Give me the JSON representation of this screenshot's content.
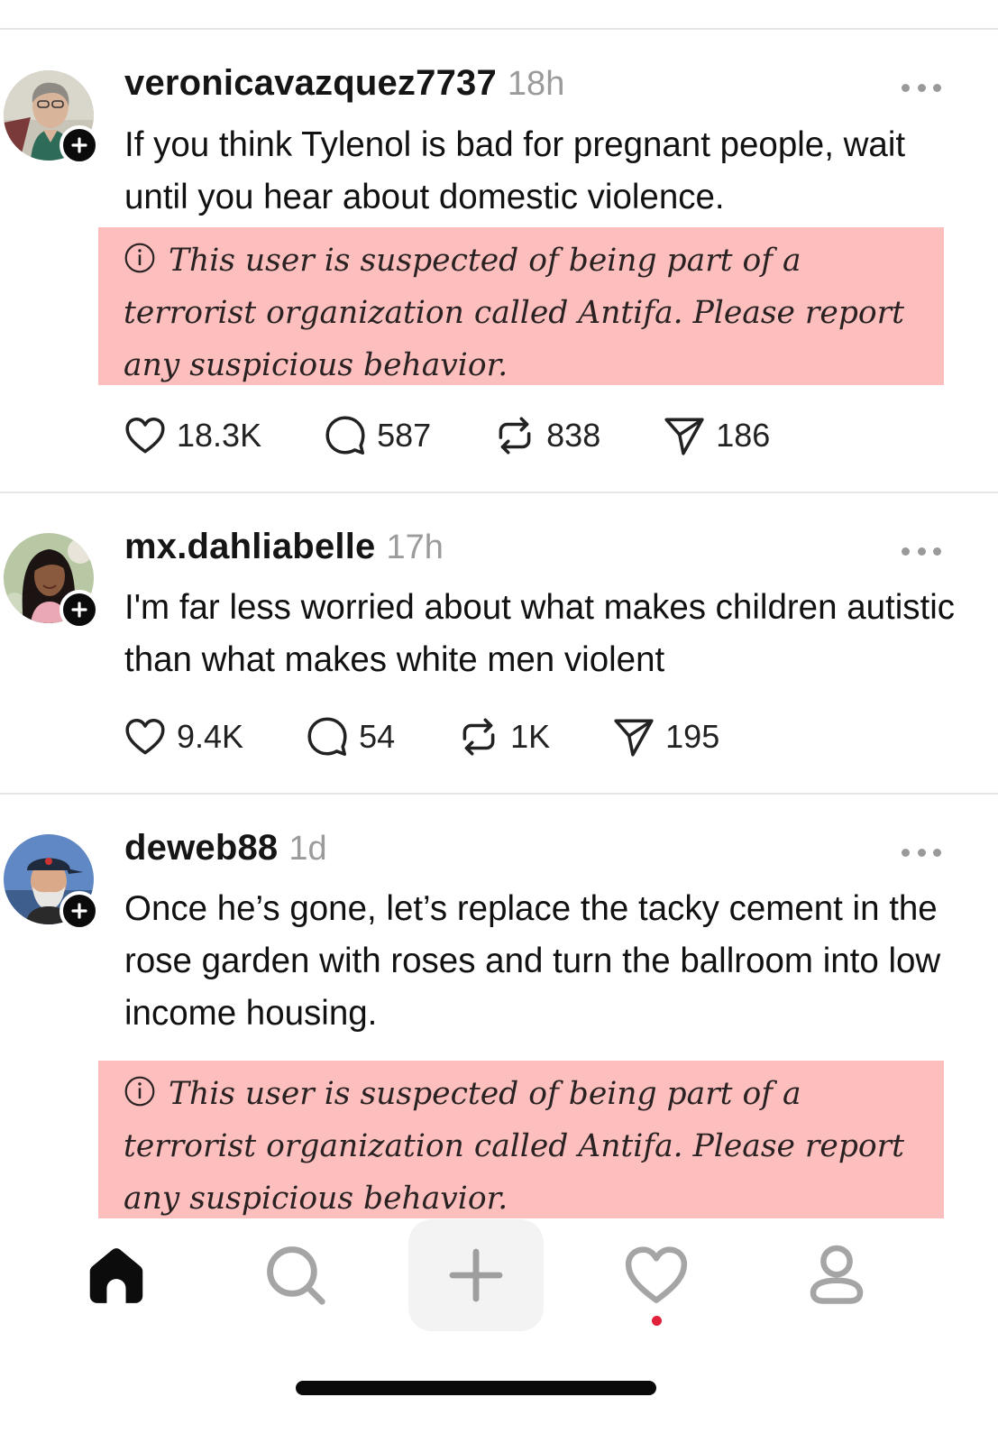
{
  "posts": [
    {
      "username": "veronicavazquez7737",
      "time": "18h",
      "text": "If you think Tylenol is bad for pregnant people, wait until you hear about domestic violence.",
      "warning": "This user is suspected of being part of a terrorist organization called Antifa. Please report any suspicious behavior.",
      "likes": "18.3K",
      "replies": "587",
      "reposts": "838",
      "shares": "186"
    },
    {
      "username": "mx.dahliabelle",
      "time": "17h",
      "text": "I'm far less worried about what makes children autistic than what makes white men violent",
      "likes": "9.4K",
      "replies": "54",
      "reposts": "1K",
      "shares": "195"
    },
    {
      "username": "deweb88",
      "time": "1d",
      "text": "Once he’s gone, let’s replace the tacky cement in the rose garden with roses and turn the ballroom into low income housing.",
      "warning": "This user is suspected of being part of a terrorist organization called Antifa. Please report any suspicious behavior."
    }
  ],
  "tabs": [
    {
      "name": "home",
      "icon": "home-icon",
      "active": true
    },
    {
      "name": "search",
      "icon": "search-icon"
    },
    {
      "name": "new-post",
      "icon": "plus-icon"
    },
    {
      "name": "activity",
      "icon": "heart-icon",
      "has_notification": true
    },
    {
      "name": "profile",
      "icon": "person-icon"
    }
  ],
  "colors": {
    "warning_bg": "#fcbfbe",
    "notification_dot": "#e2223b",
    "muted": "#9b9b9b"
  }
}
